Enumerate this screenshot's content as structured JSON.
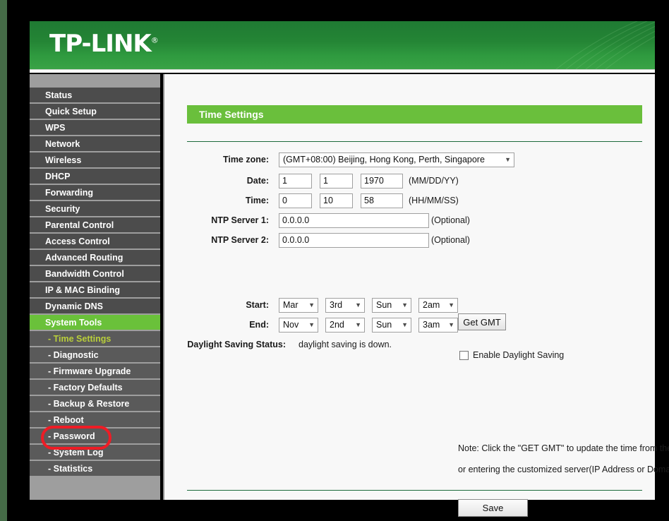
{
  "brand": {
    "logo_text": "TP-LINK",
    "registered_mark": "®"
  },
  "sidebar": {
    "items": [
      {
        "label": "Status",
        "type": "main",
        "state": "normal"
      },
      {
        "label": "Quick Setup",
        "type": "main",
        "state": "normal"
      },
      {
        "label": "WPS",
        "type": "main",
        "state": "normal"
      },
      {
        "label": "Network",
        "type": "main",
        "state": "normal"
      },
      {
        "label": "Wireless",
        "type": "main",
        "state": "normal"
      },
      {
        "label": "DHCP",
        "type": "main",
        "state": "normal"
      },
      {
        "label": "Forwarding",
        "type": "main",
        "state": "normal"
      },
      {
        "label": "Security",
        "type": "main",
        "state": "normal"
      },
      {
        "label": "Parental Control",
        "type": "main",
        "state": "normal"
      },
      {
        "label": "Access Control",
        "type": "main",
        "state": "normal"
      },
      {
        "label": "Advanced Routing",
        "type": "main",
        "state": "normal"
      },
      {
        "label": "Bandwidth Control",
        "type": "main",
        "state": "normal"
      },
      {
        "label": "IP & MAC Binding",
        "type": "main",
        "state": "normal"
      },
      {
        "label": "Dynamic DNS",
        "type": "main",
        "state": "normal"
      },
      {
        "label": "System Tools",
        "type": "main",
        "state": "active"
      },
      {
        "label": "- Time Settings",
        "type": "sub",
        "state": "sub-active"
      },
      {
        "label": "- Diagnostic",
        "type": "sub",
        "state": "normal"
      },
      {
        "label": "- Firmware Upgrade",
        "type": "sub",
        "state": "normal"
      },
      {
        "label": "- Factory Defaults",
        "type": "sub",
        "state": "normal"
      },
      {
        "label": "- Backup & Restore",
        "type": "sub",
        "state": "normal"
      },
      {
        "label": "- Reboot",
        "type": "sub",
        "state": "normal"
      },
      {
        "label": "- Password",
        "type": "sub",
        "state": "normal"
      },
      {
        "label": "- System Log",
        "type": "sub",
        "state": "normal"
      },
      {
        "label": "- Statistics",
        "type": "sub",
        "state": "normal"
      }
    ],
    "annotation": {
      "target_label": "- Reboot",
      "shape": "rounded-rectangle",
      "color": "#ee1c25"
    }
  },
  "main": {
    "section_title": "Time Settings",
    "timezone": {
      "label": "Time zone:",
      "selected": "(GMT+08:00) Beijing, Hong Kong, Perth, Singapore"
    },
    "date": {
      "label": "Date:",
      "month": "1",
      "day": "1",
      "year": "1970",
      "format_hint": "(MM/DD/YY)"
    },
    "time": {
      "label": "Time:",
      "hour": "0",
      "minute": "10",
      "second": "58",
      "format_hint": "(HH/MM/SS)"
    },
    "ntp_server_1": {
      "label": "NTP Server 1:",
      "value": "0.0.0.0",
      "hint": "(Optional)"
    },
    "ntp_server_2": {
      "label": "NTP Server 2:",
      "value": "0.0.0.0",
      "hint": "(Optional)"
    },
    "get_gmt_button": "Get GMT",
    "daylight_saving": {
      "checkbox_label": "Enable Daylight Saving",
      "checked": false,
      "start": {
        "label": "Start:",
        "month": "Mar",
        "week": "3rd",
        "day": "Sun",
        "hour": "2am"
      },
      "end": {
        "label": "End:",
        "month": "Nov",
        "week": "2nd",
        "day": "Sun",
        "hour": "3am"
      },
      "status_label": "Daylight Saving Status:",
      "status_value": "daylight saving is down."
    },
    "note_line_1": "Note: Click the \"GET GMT\" to update the time from the internet with the pre-defined servers",
    "note_line_2": "or entering the customized server(IP Address or Domain Name) in the above frames.",
    "save_button": "Save"
  },
  "colors": {
    "brand_green_dark": "#1f7a33",
    "brand_green_light": "#3aa346",
    "accent_green": "#6abf3c",
    "sidebar_item": "#4c4c4c",
    "sidebar_sub": "#5a5a5a",
    "sub_active_text": "#b9cf3a",
    "annotation_red": "#ee1c25"
  }
}
